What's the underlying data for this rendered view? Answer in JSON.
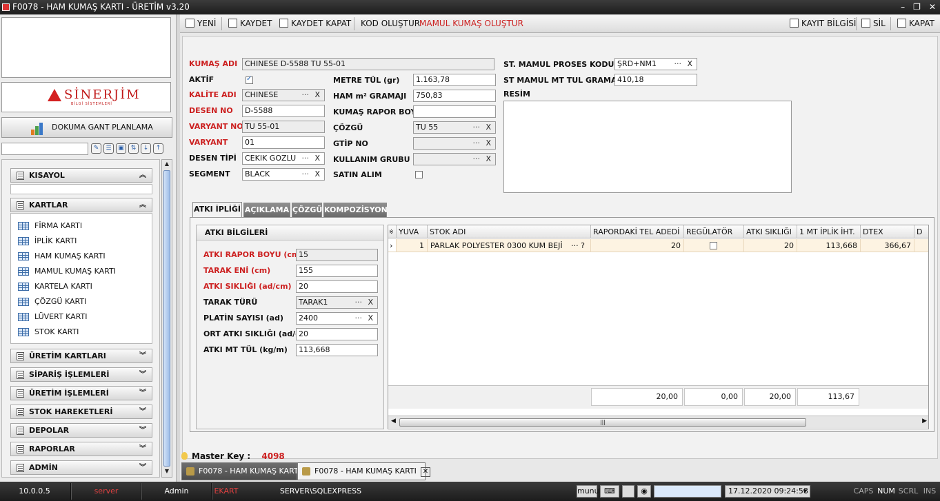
{
  "window": {
    "title": "F0078 - HAM KUMAŞ KARTI - ÜRETİM v3.20",
    "minimize": "–",
    "restore": "❐",
    "close": "✕"
  },
  "logo": {
    "name": "SİNERJİM",
    "subtitle": "BİLGİ SİSTEMLERİ"
  },
  "sidebar": {
    "gant_button": "DOKUMA GANT PLANLAMA",
    "search_value": "",
    "groups": [
      {
        "label": "KISAYOL",
        "chevron": "︽"
      },
      {
        "label": "KARTLAR",
        "chevron": "︽"
      },
      {
        "label": "ÜRETİM KARTLARI",
        "chevron": "︾"
      },
      {
        "label": "SİPARİŞ İŞLEMLERİ",
        "chevron": "︾"
      },
      {
        "label": "ÜRETİM İŞLEMLERİ",
        "chevron": "︾"
      },
      {
        "label": "STOK HAREKETLERİ",
        "chevron": "︾"
      },
      {
        "label": "DEPOLAR",
        "chevron": "︾"
      },
      {
        "label": "RAPORLAR",
        "chevron": "︾"
      },
      {
        "label": "ADMİN",
        "chevron": "︾"
      }
    ],
    "kartlar_items": [
      "FİRMA KARTI",
      "İPLİK KARTI",
      "HAM KUMAŞ KARTI",
      "MAMUL KUMAŞ KARTI",
      "KARTELA KARTI",
      "ÇÖZGÜ KARTI",
      "LÜVERT KARTI",
      "STOK KARTI"
    ]
  },
  "toolbar": {
    "new": "YENİ",
    "save": "KAYDET",
    "save_close": "KAYDET KAPAT",
    "code_gen": "KOD OLUŞTUR",
    "mamul_gen": "MAMUL KUMAŞ OLUŞTUR",
    "record_info": "KAYIT BİLGİSİ",
    "delete": "SİL",
    "close": "KAPAT"
  },
  "form": {
    "kumas_adi": {
      "label": "KUMAŞ ADI",
      "value": "CHINESE  D-5588 TU 55-01"
    },
    "aktif": {
      "label": "AKTİF",
      "checked": true
    },
    "kalite_adi": {
      "label": "KALİTE ADI",
      "value": "CHINESE"
    },
    "desen_no": {
      "label": "DESEN NO",
      "value": "D-5588"
    },
    "varyant_no": {
      "label": "VARYANT NO",
      "value": "TU 55-01"
    },
    "varyant": {
      "label": "VARYANT",
      "value": "01"
    },
    "desen_tipi": {
      "label": "DESEN TİPİ",
      "value": "CEKIK GOZLU"
    },
    "segment": {
      "label": "SEGMENT",
      "value": "BLACK"
    },
    "metre_tul": {
      "label": "METRE TÜL (gr)",
      "value": "1.163,78"
    },
    "ham_m2": {
      "label": "HAM m² GRAMAJI",
      "value": "750,83"
    },
    "kumas_rapor_boyu": {
      "label": "KUMAŞ RAPOR BOYU",
      "value": ""
    },
    "cozgu": {
      "label": "ÇÖZGÜ",
      "value": "TU 55"
    },
    "gtip_no": {
      "label": "GTİP NO",
      "value": ""
    },
    "kullanim_grubu": {
      "label": "KULLANIM GRUBU",
      "value": ""
    },
    "satin_alim": {
      "label": "SATIN ALIM",
      "checked": false
    },
    "st_mamul_proses": {
      "label": "ST. MAMUL PROSES KODU",
      "value": "ŞRD+NM1"
    },
    "st_mamul_gramaj": {
      "label": "ST MAMUL MT TUL GRAMAJI",
      "value": "410,18"
    },
    "resim": {
      "label": "RESİM"
    },
    "dots": "···",
    "clear": "X"
  },
  "tabs": [
    "ATKI İPLİĞİ",
    "AÇIKLAMA",
    "ÇÖZGÜ",
    "KOMPOZİSYON"
  ],
  "atki": {
    "header": "ATKI BİLGİLERİ",
    "fields": [
      {
        "label": "ATKI RAPOR BOYU (cm)",
        "value": "15"
      },
      {
        "label": "TARAK ENİ (cm)",
        "value": "155"
      },
      {
        "label": "ATKI SIKLIĞI (ad/cm)",
        "value": "20"
      },
      {
        "label": "TARAK TÜRÜ",
        "value": "TARAK1"
      },
      {
        "label": "PLATİN SAYISI (ad)",
        "value": "2400"
      },
      {
        "label": "ORT ATKI SIKLIĞI (ad/cm)",
        "value": "20"
      },
      {
        "label": "ATKI MT TÜL (kg/m)",
        "value": "113,668"
      }
    ]
  },
  "grid": {
    "indicator_header": "※",
    "headers": [
      "YUVA",
      "STOK ADI",
      "RAPORDAKİ TEL ADEDİ",
      "REGÜLATÖR",
      "ATKI SIKLIĞI",
      "1 MT İPLİK İHT.",
      "DTEX",
      "D"
    ],
    "row_indicator": "›",
    "rows": [
      {
        "yuva": "1",
        "stok_adi": "PARLAK POLYESTER 0300 KUM BEJİ",
        "more": "··· ?",
        "tel_adedi": "20",
        "regulator": false,
        "atki_sikligi": "20",
        "iplik_iht": "113,668",
        "dtex": "366,67"
      }
    ],
    "footer": [
      "20,00",
      "0,00",
      "20,00",
      "113,67"
    ],
    "scroll_grip": "|||"
  },
  "master_key": {
    "label": "Master Key :",
    "value": "4098"
  },
  "doc_tabs": [
    "F0078 - HAM KUMAŞ KARTI",
    "F0078 - HAM KUMAŞ KARTI"
  ],
  "status": {
    "ip": "10.0.0.5",
    "server_label": "server",
    "user": "Admin",
    "module": "EKART",
    "db": "SERVER\\SQLEXPRESS",
    "lang": "munul",
    "datetime": "17.12.2020 09:24:58",
    "caps": "CAPS",
    "num": "NUM",
    "scrl": "SCRL",
    "ins": "INS"
  },
  "colors": {
    "accent_red": "#cc2020",
    "dark_bar": "#2a2a2a"
  }
}
